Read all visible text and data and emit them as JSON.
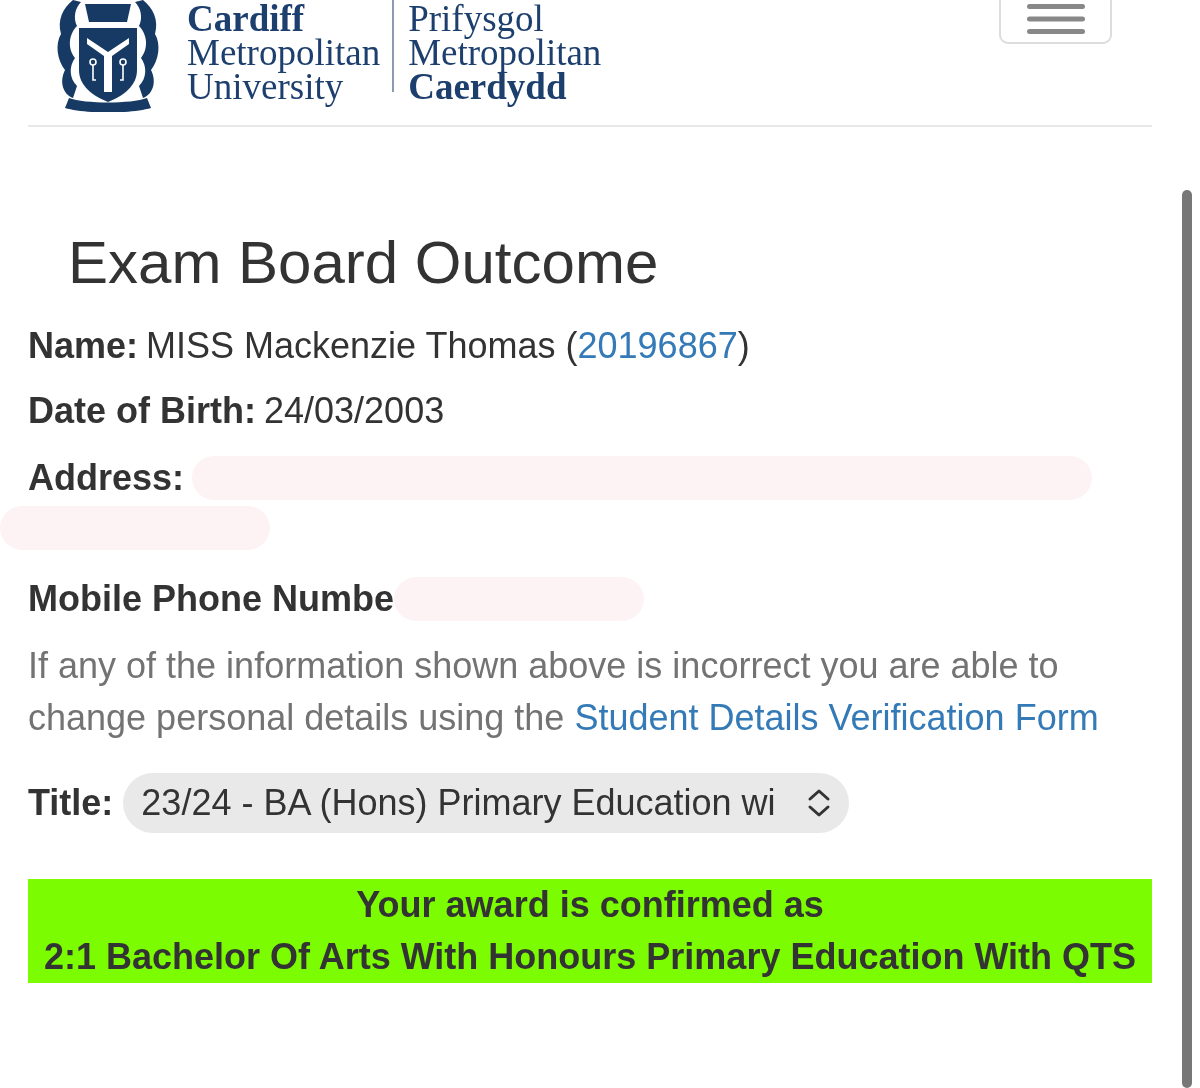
{
  "header": {
    "logo": {
      "english": [
        "**Cardiff**",
        "Metropolitan",
        "University"
      ],
      "welsh": [
        "Prifysgol",
        "Metropolitan",
        "**Caerdydd**"
      ]
    }
  },
  "page": {
    "title": "Exam Board Outcome",
    "details": [
      {
        "kind": "linked",
        "label": "Name:",
        "value": "MISS Mackenzie Thomas (",
        "link": "20196867",
        "value_end": ")"
      },
      {
        "kind": "plain",
        "label": "Date of Birth:",
        "value": "24/03/2003"
      },
      {
        "kind": "redacted_address",
        "label": "Address:"
      },
      {
        "kind": "redacted_inline",
        "label": "Mobile Phone Numbe"
      }
    ],
    "notice": {
      "text": "If any of the information shown above is incorrect you are able to change personal details using the ",
      "link": "Student Details Verification Form"
    },
    "title_select": {
      "label": "Title:",
      "value": "23/24 - BA (Hons) Primary Education wi"
    },
    "award": {
      "lines": [
        "Your award is confirmed as",
        "2:1 Bachelor Of Arts With Honours Primary Education With QTS"
      ]
    }
  }
}
